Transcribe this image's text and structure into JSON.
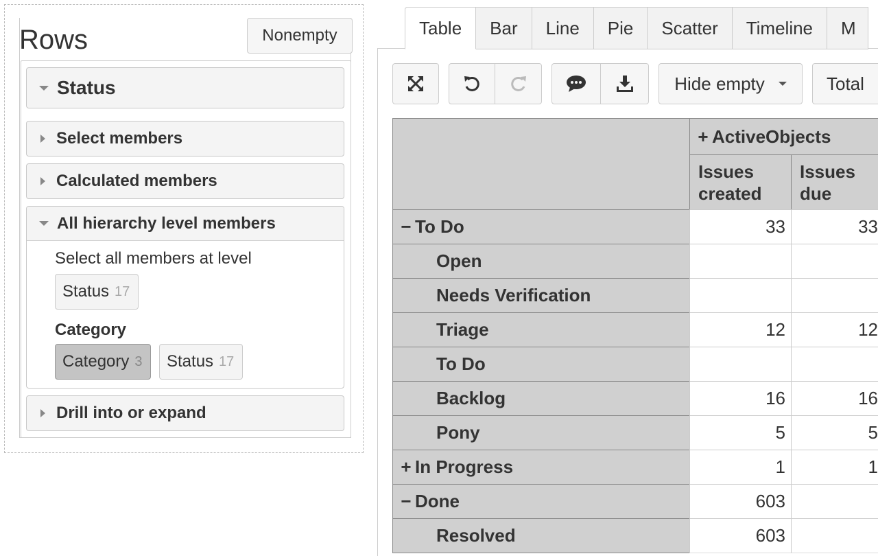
{
  "rows_panel": {
    "title": "Rows",
    "nonempty_label": "Nonempty",
    "status_heading": "Status",
    "sections": {
      "select_members": "Select members",
      "calculated_members": "Calculated members",
      "all_hierarchy_level_members": "All hierarchy level members",
      "drill_into_or_expand": "Drill into or expand"
    },
    "select_all_label": "Select all members at level",
    "level_chips": [
      {
        "label": "Status",
        "count": "17"
      }
    ],
    "category_label": "Category",
    "category_chips": [
      {
        "label": "Category",
        "count": "3",
        "active": true
      },
      {
        "label": "Status",
        "count": "17",
        "active": false
      }
    ]
  },
  "tabs": [
    "Table",
    "Bar",
    "Line",
    "Pie",
    "Scatter",
    "Timeline",
    "M"
  ],
  "active_tab": "Table",
  "toolbar": {
    "icons": [
      "expand-icon",
      "undo-icon",
      "redo-icon",
      "comment-icon",
      "download-icon"
    ],
    "hide_empty_label": "Hide empty",
    "total_label": "Total"
  },
  "table": {
    "measure_group": "ActiveObjects",
    "columns": [
      "Issues created",
      "Issues due"
    ],
    "column_lines": [
      [
        "Issues",
        "created"
      ],
      [
        "Issues",
        "due"
      ]
    ],
    "rows": [
      {
        "label": "To Do",
        "indent": 0,
        "toggle": "−",
        "values": [
          "33",
          "33"
        ]
      },
      {
        "label": "Open",
        "indent": 1,
        "toggle": "",
        "values": [
          "",
          ""
        ]
      },
      {
        "label": "Needs Verification",
        "indent": 1,
        "toggle": "",
        "values": [
          "",
          ""
        ]
      },
      {
        "label": "Triage",
        "indent": 1,
        "toggle": "",
        "values": [
          "12",
          "12"
        ]
      },
      {
        "label": "To Do",
        "indent": 1,
        "toggle": "",
        "values": [
          "",
          ""
        ]
      },
      {
        "label": "Backlog",
        "indent": 1,
        "toggle": "",
        "values": [
          "16",
          "16"
        ]
      },
      {
        "label": "Pony",
        "indent": 1,
        "toggle": "",
        "values": [
          "5",
          "5"
        ]
      },
      {
        "label": "In Progress",
        "indent": 0,
        "toggle": "+",
        "values": [
          "1",
          "1"
        ]
      },
      {
        "label": "Done",
        "indent": 0,
        "toggle": "−",
        "values": [
          "603",
          ""
        ]
      },
      {
        "label": "Resolved",
        "indent": 1,
        "toggle": "",
        "values": [
          "603",
          ""
        ]
      }
    ]
  },
  "colors": {
    "header_gray": "#d0d0d0",
    "border": "#cccccc",
    "chip_active": "#c4c4c4"
  }
}
